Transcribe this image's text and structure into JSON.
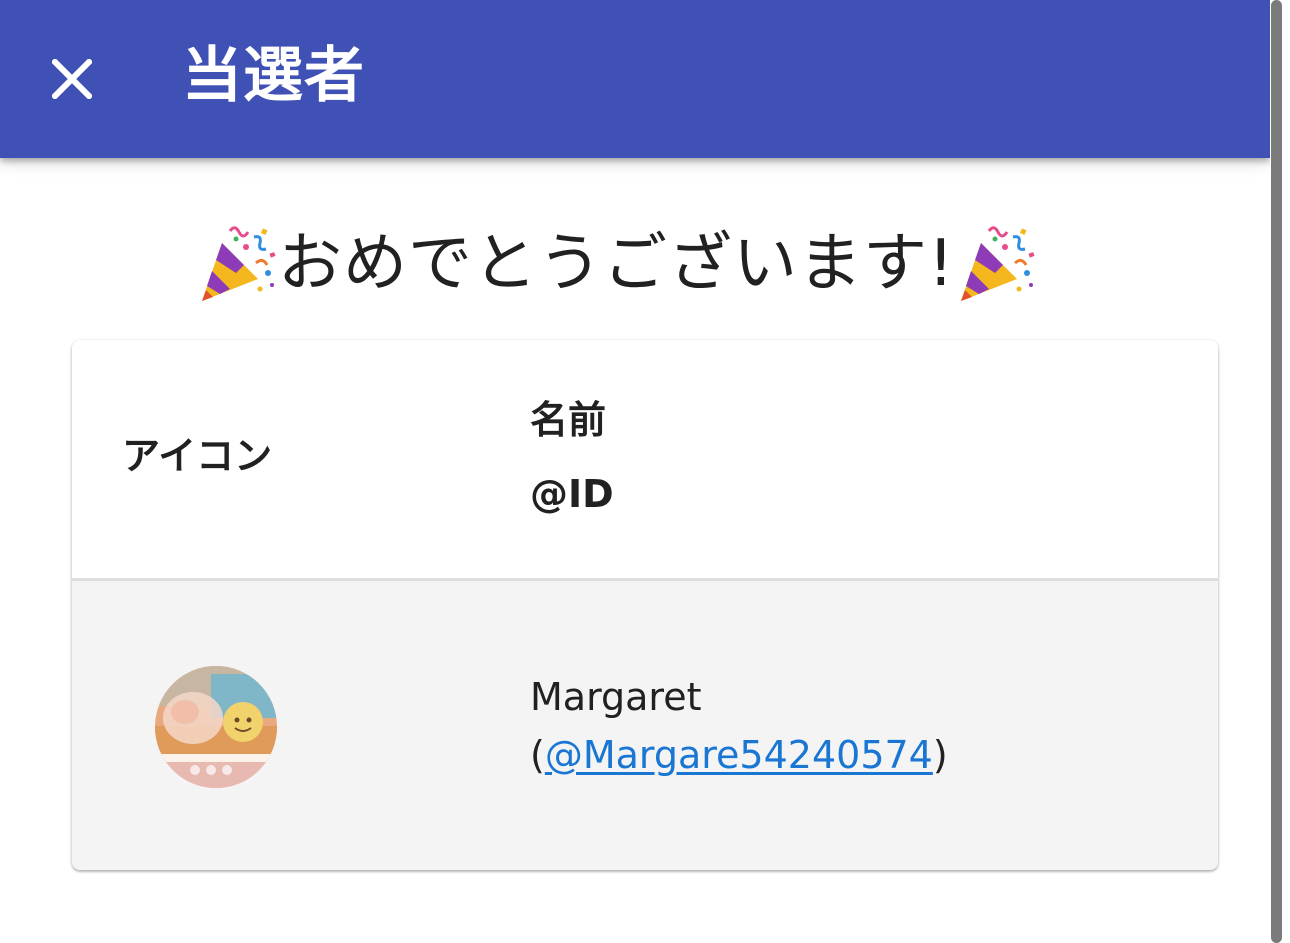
{
  "app_bar": {
    "title": "当選者",
    "background_color": "#3f51b5",
    "close_icon": "close-icon"
  },
  "heading": {
    "text": "おめでとうございます!",
    "decoration_icon": "party-popper-icon"
  },
  "table": {
    "columns": {
      "icon_label": "アイコン",
      "name_label": "名前",
      "id_label": "@ID"
    },
    "rows": [
      {
        "avatar": "user-avatar-photo",
        "name": "Margaret",
        "handle_open": "(",
        "handle": "@Margare54240574",
        "handle_close": ")"
      }
    ]
  },
  "colors": {
    "link": "#1976d2",
    "row_background": "#f4f4f4"
  }
}
